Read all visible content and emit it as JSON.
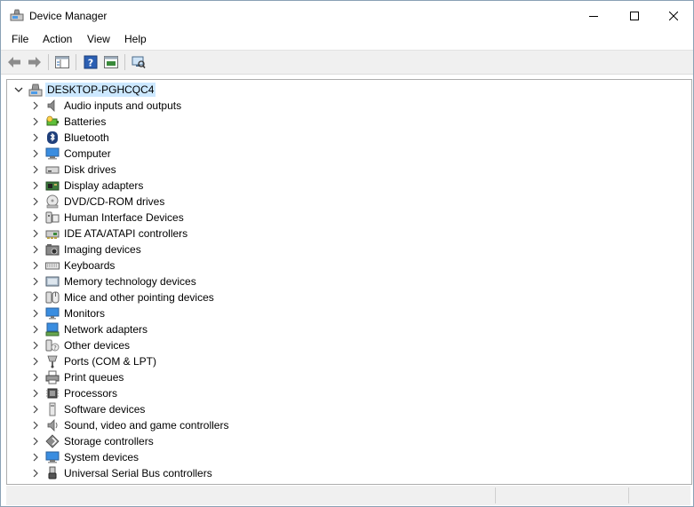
{
  "window": {
    "title": "Device Manager"
  },
  "menu": [
    "File",
    "Action",
    "View",
    "Help"
  ],
  "tree": {
    "root": "DESKTOP-PGHCQC4",
    "items": [
      {
        "label": "Audio inputs and outputs",
        "icon": "speaker-icon"
      },
      {
        "label": "Batteries",
        "icon": "battery-icon"
      },
      {
        "label": "Bluetooth",
        "icon": "bluetooth-icon"
      },
      {
        "label": "Computer",
        "icon": "computer-icon"
      },
      {
        "label": "Disk drives",
        "icon": "disk-drive-icon"
      },
      {
        "label": "Display adapters",
        "icon": "display-adapter-icon"
      },
      {
        "label": "DVD/CD-ROM drives",
        "icon": "dvd-drive-icon"
      },
      {
        "label": "Human Interface Devices",
        "icon": "hid-icon"
      },
      {
        "label": "IDE ATA/ATAPI controllers",
        "icon": "ide-controller-icon"
      },
      {
        "label": "Imaging devices",
        "icon": "camera-icon"
      },
      {
        "label": "Keyboards",
        "icon": "keyboard-icon"
      },
      {
        "label": "Memory technology devices",
        "icon": "memory-device-icon"
      },
      {
        "label": "Mice and other pointing devices",
        "icon": "mouse-icon"
      },
      {
        "label": "Monitors",
        "icon": "monitor-icon"
      },
      {
        "label": "Network adapters",
        "icon": "network-adapter-icon"
      },
      {
        "label": "Other devices",
        "icon": "unknown-device-icon"
      },
      {
        "label": "Ports (COM & LPT)",
        "icon": "port-icon"
      },
      {
        "label": "Print queues",
        "icon": "printer-icon"
      },
      {
        "label": "Processors",
        "icon": "processor-icon"
      },
      {
        "label": "Software devices",
        "icon": "software-device-icon"
      },
      {
        "label": "Sound, video and game controllers",
        "icon": "sound-controller-icon"
      },
      {
        "label": "Storage controllers",
        "icon": "storage-controller-icon"
      },
      {
        "label": "System devices",
        "icon": "system-device-icon"
      },
      {
        "label": "Universal Serial Bus controllers",
        "icon": "usb-icon"
      }
    ]
  },
  "colors": {
    "selection": "#cce8ff",
    "toolbar_bg": "#f0f0f0",
    "accent": "#1e7bd6"
  }
}
